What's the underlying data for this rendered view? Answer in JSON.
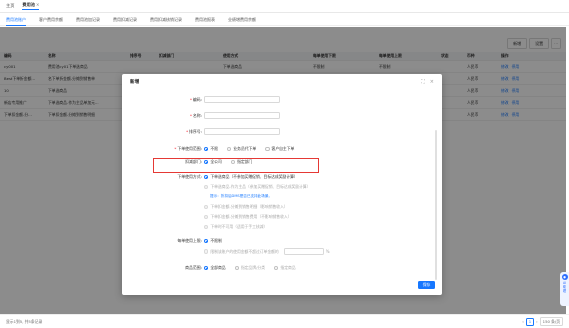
{
  "topbar": {
    "home": "主页",
    "current": "费用池"
  },
  "tabs": [
    "费用池账户",
    "客户费用余额",
    "费用池加记录",
    "费用扣减记录",
    "费用扣减核销记录",
    "费用池报表",
    "业绩增费用余额"
  ],
  "toolbar": {
    "add": "新增",
    "settings": "设置",
    "more": "···"
  },
  "table": {
    "headers": [
      "编码",
      "名称",
      "排序号",
      "扣减部门",
      "使用方式",
      "每单使用下限",
      "每单使用上限",
      "状态",
      "币种",
      "操作"
    ],
    "rows": [
      [
        "cy001",
        "费用池cy01下单选商品",
        "",
        "",
        "下单选商品",
        "不限制",
        "不限制",
        "",
        "人民币",
        "修改 停用"
      ],
      [
        "Best下单折金额...",
        "名下单折金额-分摊到销售单",
        "",
        "",
        "下单选商品-作为主...",
        "",
        "",
        "",
        "人民币",
        "修改 停用"
      ],
      [
        "10",
        "下单选商品",
        "",
        "",
        "下单选商品",
        "",
        "",
        "",
        "人民币",
        "修改 停用"
      ],
      [
        "新店专用推广",
        "下单选商品-作为主品单加元...",
        "",
        "",
        "下单选商品-作为...",
        "",
        "",
        "",
        "人民币",
        "修改 停用"
      ],
      [
        "下单扣金额-分...",
        "下单扣金额-分摊到销售明细",
        "",
        "",
        "下单扣金额-分摊...",
        "",
        "",
        "",
        "人民币",
        "修改 停用"
      ]
    ]
  },
  "footer": {
    "summary": "显示1到5, 共5条记录",
    "page": "1",
    "page_size": "150 条/页"
  },
  "modal": {
    "title": "新增",
    "labels": {
      "code": "编码",
      "name": "名称",
      "sort": "排序号",
      "order_range": "下单使用范围",
      "deduct_dept": "扣减部门",
      "usage": "下单使用方式",
      "upper_limit": "每单使用上限",
      "scope": "商品范围"
    },
    "order_range_options": [
      "不限",
      "业务员代下单",
      "客户自主下单"
    ],
    "dept_options": [
      "全公司",
      "指定部门"
    ],
    "usage_options": [
      "下单选商品（不参加买赠促销、目标达成奖励计算）",
      "下单选商品-作为主品（参加买赠促销、目标达成奖励计算）",
      "下单扣金额-分摊到销售明细（影响销售收入）",
      "下单扣金额-分摊到销售费用（不影响销售收入）",
      "下单时不可用（适用于手工核减）"
    ],
    "usage_hint": "提示：折扣后DMS是否已支持此场景。",
    "limit_options": [
      "不限制",
      "限制该账户的使用金额不超过订单金额的"
    ],
    "pct": "%",
    "scope_options": [
      "全部商品",
      "指定品牌/分类",
      "指定商品"
    ],
    "save": "保存"
  },
  "ai": {
    "label": "AI助理"
  },
  "colors": {
    "primary": "#1677ff",
    "highlight": "#e53935"
  }
}
